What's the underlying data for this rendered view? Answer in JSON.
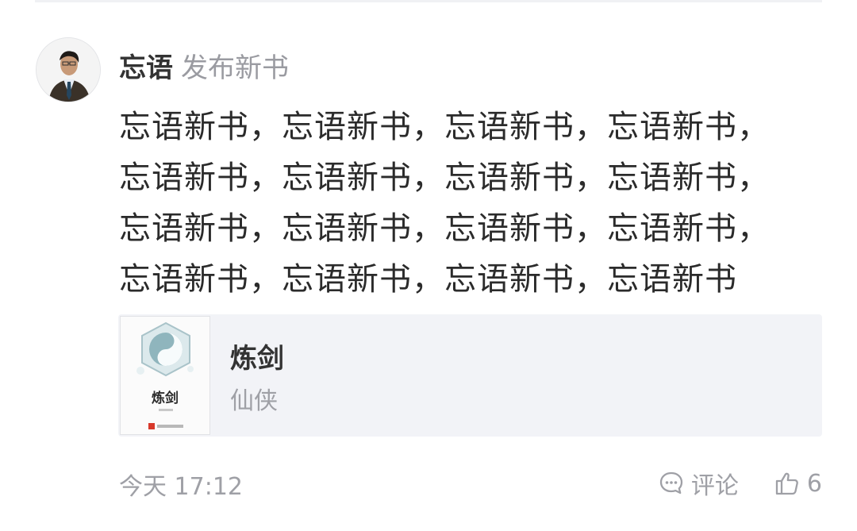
{
  "post": {
    "author_name": "忘语",
    "action_text": "发布新书",
    "text": "忘语新书，忘语新书，忘语新书，忘语新书，忘语新书，忘语新书，忘语新书，忘语新书，忘语新书，忘语新书，忘语新书，忘语新书，忘语新书，忘语新书，忘语新书，忘语新书",
    "timestamp": "今天 17:12"
  },
  "book": {
    "title": "炼剑",
    "genre": "仙侠",
    "cover_title": "炼剑"
  },
  "actions": {
    "comment_label": "评论",
    "like_count": "6"
  },
  "icons": {
    "avatar": "author-avatar",
    "comment": "comment-icon",
    "like": "thumbs-up-icon",
    "cover_emblem": "taiji-emblem"
  },
  "colors": {
    "primary_text": "#2b2b2b",
    "secondary_text": "#9fa0a6",
    "card_background": "#f2f3f7",
    "publisher_mark": "#d8392b"
  }
}
